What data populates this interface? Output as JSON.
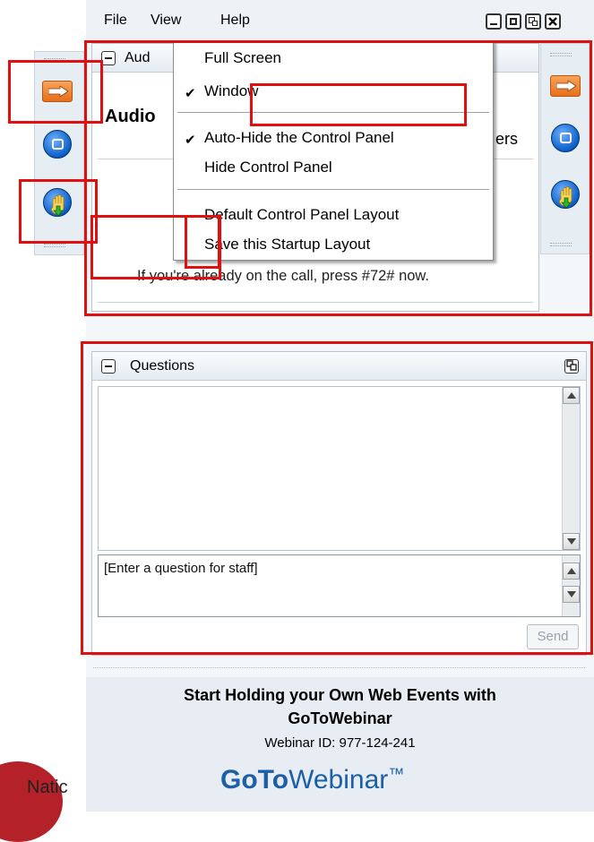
{
  "menu": {
    "file": "File",
    "view": "View",
    "help": "Help"
  },
  "window_controls": [
    "minimize",
    "restore",
    "detach",
    "close"
  ],
  "audio_panel": {
    "header_label": "Aud",
    "title": "Audio",
    "partial_text": "ers",
    "instruction": "If you're already on the call, press #72# now."
  },
  "view_menu": {
    "items": [
      {
        "label": "Full Screen",
        "checked": false
      },
      {
        "label": "Window",
        "checked": true
      },
      {
        "label": "Auto-Hide the Control Panel",
        "checked": true
      },
      {
        "label": "Hide Control Panel",
        "checked": false
      },
      {
        "label": "Default Control Panel Layout",
        "checked": false
      },
      {
        "label": "Save this Startup Layout",
        "checked": false
      }
    ]
  },
  "questions_panel": {
    "title": "Questions",
    "input_placeholder": "[Enter a question for staff]",
    "send_label": "Send"
  },
  "promo": {
    "line1": "Start Holding your Own Web Events with",
    "line2": "GoToWebinar",
    "webinar_id": "Webinar ID: 977-124-241"
  },
  "logo": {
    "goto": "GoTo",
    "webinar": "Webinar",
    "tm": "™"
  },
  "footer_partial": "Natic",
  "colors": {
    "highlight_red": "#e01010",
    "accent_orange": "#e86f1a",
    "brand_blue": "#1c5fa8"
  }
}
